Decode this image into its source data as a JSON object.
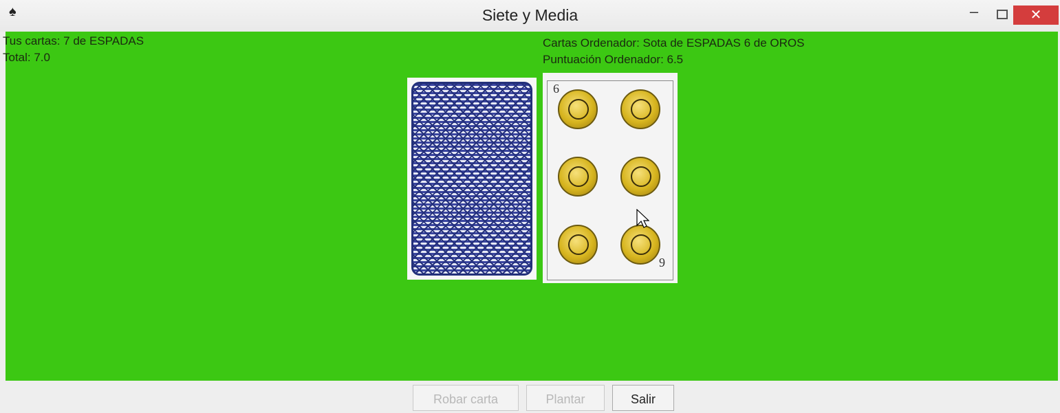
{
  "window": {
    "title": "Siete y Media",
    "app_icon": "spade-icon",
    "controls": {
      "minimize": "–",
      "maximize": "□",
      "close": "✕"
    }
  },
  "player": {
    "cards_text": "Tus cartas: 7 de ESPADAS",
    "total_text": "Total: 7.0"
  },
  "computer": {
    "cards_text": "Cartas Ordenador: Sota de ESPADAS 6 de OROS",
    "score_text": "Puntuación Ordenador: 6.5"
  },
  "table": {
    "cards": [
      {
        "face": "back"
      },
      {
        "face": "6 de OROS",
        "corner_top": "6",
        "corner_bottom": "9"
      }
    ]
  },
  "buttons": {
    "draw": {
      "label": "Robar carta",
      "enabled": false
    },
    "stand": {
      "label": "Plantar",
      "enabled": false
    },
    "exit": {
      "label": "Salir",
      "enabled": true
    }
  },
  "colors": {
    "table_felt": "#3cc813",
    "card_back": "#24307c",
    "coin_gold": "#d7b51f",
    "close_button": "#d43d3d"
  }
}
